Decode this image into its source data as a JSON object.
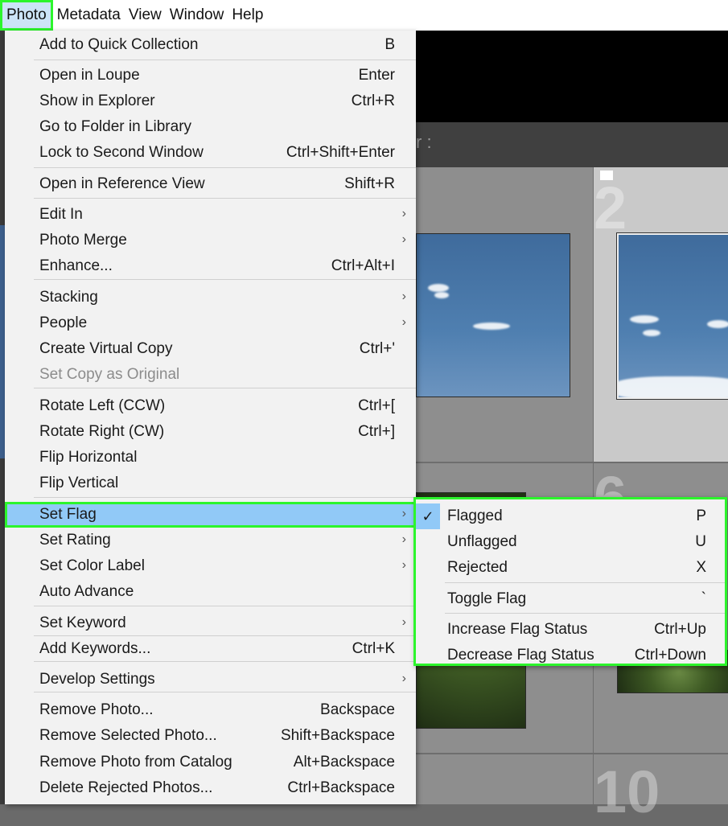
{
  "menubar": {
    "items": [
      "Photo",
      "Metadata",
      "View",
      "Window",
      "Help"
    ]
  },
  "background": {
    "bar_text": "r :",
    "cell_numbers": [
      "2",
      "6",
      "10"
    ]
  },
  "photo_menu": {
    "items": [
      {
        "label": "Add to Quick Collection",
        "shortcut": "B"
      },
      {
        "label": "Open in Loupe",
        "shortcut": "Enter"
      },
      {
        "label": "Show in Explorer",
        "shortcut": "Ctrl+R"
      },
      {
        "label": "Go to Folder in Library",
        "shortcut": ""
      },
      {
        "label": "Lock to Second Window",
        "shortcut": "Ctrl+Shift+Enter"
      },
      {
        "label": "Open in Reference View",
        "shortcut": "Shift+R"
      },
      {
        "label": "Edit In",
        "shortcut": "",
        "arrow": "›"
      },
      {
        "label": "Photo Merge",
        "shortcut": "",
        "arrow": "›"
      },
      {
        "label": "Enhance...",
        "shortcut": "Ctrl+Alt+I"
      },
      {
        "label": "Stacking",
        "shortcut": "",
        "arrow": "›"
      },
      {
        "label": "People",
        "shortcut": "",
        "arrow": "›"
      },
      {
        "label": "Create Virtual Copy",
        "shortcut": "Ctrl+'"
      },
      {
        "label": "Set Copy as Original",
        "shortcut": "",
        "disabled": true
      },
      {
        "label": "Rotate Left (CCW)",
        "shortcut": "Ctrl+["
      },
      {
        "label": "Rotate Right (CW)",
        "shortcut": "Ctrl+]"
      },
      {
        "label": "Flip Horizontal",
        "shortcut": ""
      },
      {
        "label": "Flip Vertical",
        "shortcut": ""
      },
      {
        "label": "Set Flag",
        "shortcut": "",
        "arrow": "›",
        "highlighted": true
      },
      {
        "label": "Set Rating",
        "shortcut": "",
        "arrow": "›"
      },
      {
        "label": "Set Color Label",
        "shortcut": "",
        "arrow": "›"
      },
      {
        "label": "Auto Advance",
        "shortcut": ""
      },
      {
        "label": "Set Keyword",
        "shortcut": "",
        "arrow": "›"
      },
      {
        "label": "Add Keywords...",
        "shortcut": "Ctrl+K"
      },
      {
        "label": "Develop Settings",
        "shortcut": "",
        "arrow": "›"
      },
      {
        "label": "Remove Photo...",
        "shortcut": "Backspace"
      },
      {
        "label": "Remove Selected Photo...",
        "shortcut": "Shift+Backspace"
      },
      {
        "label": "Remove Photo from Catalog",
        "shortcut": "Alt+Backspace"
      },
      {
        "label": "Delete Rejected Photos...",
        "shortcut": "Ctrl+Backspace"
      }
    ]
  },
  "set_flag_submenu": {
    "check_glyph": "✓",
    "items": [
      {
        "label": "Flagged",
        "shortcut": "P",
        "checked": true
      },
      {
        "label": "Unflagged",
        "shortcut": "U"
      },
      {
        "label": "Rejected",
        "shortcut": "X"
      },
      {
        "label": "Toggle Flag",
        "shortcut": "`"
      },
      {
        "label": "Increase Flag Status",
        "shortcut": "Ctrl+Up"
      },
      {
        "label": "Decrease Flag Status",
        "shortcut": "Ctrl+Down"
      }
    ]
  },
  "colors": {
    "highlight_outline": "#2cf52c",
    "menu_highlight": "#91c9f7",
    "menu_bg": "#f2f2f2"
  }
}
